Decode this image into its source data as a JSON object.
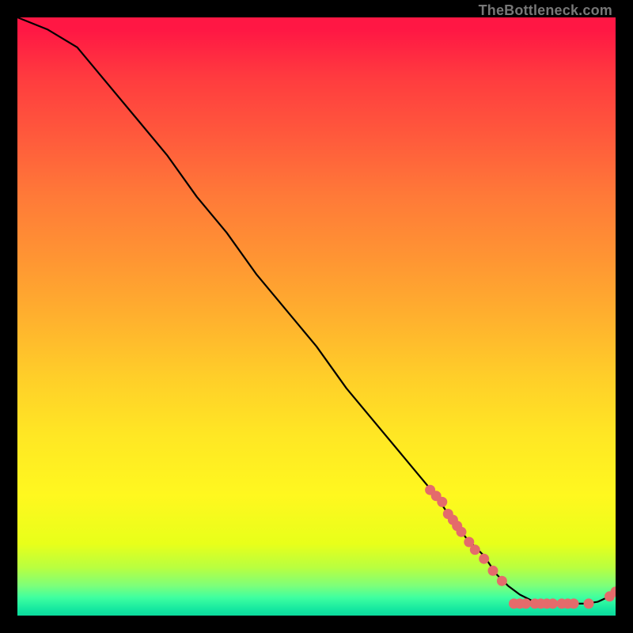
{
  "attribution": "TheBottleneck.com",
  "chart_data": {
    "type": "line",
    "title": "",
    "xlabel": "",
    "ylabel": "",
    "xlim": [
      0,
      100
    ],
    "ylim": [
      0,
      100
    ],
    "series": [
      {
        "name": "curve",
        "x": [
          0,
          5,
          10,
          15,
          20,
          25,
          30,
          35,
          40,
          45,
          50,
          55,
          60,
          65,
          70,
          72,
          75,
          78,
          80,
          82,
          84,
          86,
          88,
          90,
          92,
          94,
          95,
          97,
          99,
          100
        ],
        "y": [
          100,
          98,
          95,
          89,
          83,
          77,
          70,
          64,
          57,
          51,
          45,
          38,
          32,
          26,
          20,
          17,
          13,
          10,
          7,
          5,
          3.5,
          2.5,
          2,
          2,
          2,
          2,
          2,
          2.3,
          3.2,
          4
        ]
      }
    ],
    "markers": [
      {
        "x": 69.0,
        "y": 21.0
      },
      {
        "x": 70.0,
        "y": 20.0
      },
      {
        "x": 71.0,
        "y": 19.0
      },
      {
        "x": 72.0,
        "y": 17.0
      },
      {
        "x": 72.8,
        "y": 16.0
      },
      {
        "x": 73.5,
        "y": 15.0
      },
      {
        "x": 74.2,
        "y": 14.0
      },
      {
        "x": 75.5,
        "y": 12.3
      },
      {
        "x": 76.5,
        "y": 11.0
      },
      {
        "x": 78.0,
        "y": 9.5
      },
      {
        "x": 79.5,
        "y": 7.5
      },
      {
        "x": 81.0,
        "y": 5.8
      },
      {
        "x": 83.0,
        "y": 2.0
      },
      {
        "x": 84.0,
        "y": 2.0
      },
      {
        "x": 85.0,
        "y": 2.0
      },
      {
        "x": 86.5,
        "y": 2.0
      },
      {
        "x": 87.5,
        "y": 2.0
      },
      {
        "x": 88.5,
        "y": 2.0
      },
      {
        "x": 89.5,
        "y": 2.0
      },
      {
        "x": 91.0,
        "y": 2.0
      },
      {
        "x": 92.0,
        "y": 2.0
      },
      {
        "x": 93.0,
        "y": 2.0
      },
      {
        "x": 95.5,
        "y": 2.0
      },
      {
        "x": 99.0,
        "y": 3.2
      },
      {
        "x": 100.0,
        "y": 4.0
      }
    ],
    "marker_color": "#e46b6b",
    "line_color": "#000000"
  }
}
